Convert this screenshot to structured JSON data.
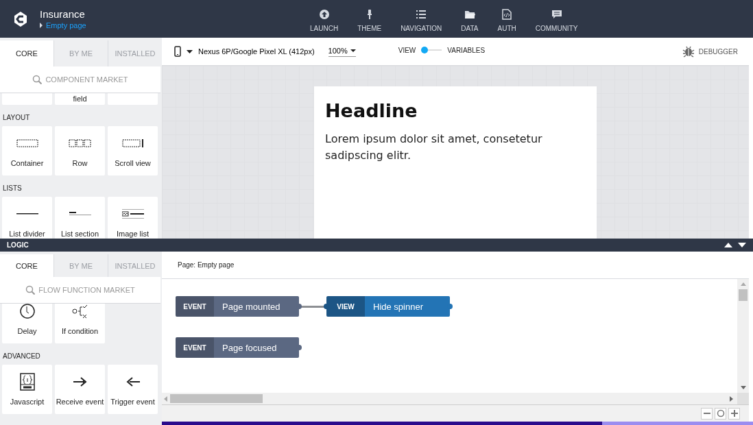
{
  "app": {
    "title": "Insurance",
    "page": "Empty page"
  },
  "nav": [
    {
      "label": "LAUNCH",
      "kind": "launch"
    },
    {
      "label": "THEME",
      "kind": "theme"
    },
    {
      "label": "NAVIGATION",
      "kind": "navigation"
    },
    {
      "label": "DATA",
      "kind": "data"
    },
    {
      "label": "AUTH",
      "kind": "auth"
    },
    {
      "label": "COMMUNITY",
      "kind": "community"
    }
  ],
  "components": {
    "tabs": [
      {
        "label": "CORE",
        "selected": true
      },
      {
        "label": "BY ME",
        "selected": false
      },
      {
        "label": "INSTALLED",
        "selected": false
      }
    ],
    "search": {
      "placeholder": "COMPONENT MARKET"
    },
    "sections": [
      {
        "tiles": [
          {
            "kind": "blank"
          },
          {
            "kind": "blank",
            "label": "field"
          },
          {
            "kind": "blank"
          }
        ]
      },
      {
        "title": "LAYOUT",
        "tiles": [
          {
            "kind": "container",
            "label": "Container"
          },
          {
            "kind": "row",
            "label": "Row"
          },
          {
            "kind": "scroll",
            "label": "Scroll view"
          }
        ]
      },
      {
        "title": "LISTS",
        "tiles": [
          {
            "kind": "divider",
            "label": "List divider"
          },
          {
            "kind": "section-header",
            "label": "List section"
          },
          {
            "kind": "image-list",
            "label": "Image list"
          }
        ]
      }
    ]
  },
  "toolbar": {
    "device": "Nexus 6P/Google Pixel XL (412px)",
    "zoom": "100%",
    "toggle": {
      "left": "VIEW",
      "right": "VARIABLES",
      "on": false
    },
    "debugger": "DEBUGGER"
  },
  "preview": {
    "headline": "Headline",
    "body": "Lorem ipsum dolor sit amet, consetetur sadipscing elitr."
  },
  "logic": {
    "title": "LOGIC",
    "functions": {
      "tabs": [
        {
          "label": "CORE",
          "selected": true
        },
        {
          "label": "BY ME",
          "selected": false
        },
        {
          "label": "INSTALLED",
          "selected": false
        }
      ],
      "search": {
        "placeholder": "FLOW FUNCTION MARKET"
      },
      "sections": [
        {
          "tiles": [
            {
              "kind": "delay",
              "label": "Delay"
            },
            {
              "kind": "condition",
              "label": "If condition"
            }
          ]
        },
        {
          "title": "ADVANCED",
          "tiles": [
            {
              "kind": "javascript",
              "label": "Javascript"
            },
            {
              "kind": "receive",
              "label": "Receive event"
            },
            {
              "kind": "trigger",
              "label": "Trigger event"
            }
          ]
        }
      ]
    },
    "page_label": "Page: Empty page",
    "flows": [
      {
        "nodes": [
          {
            "kind": "event",
            "tag": "EVENT",
            "label": "Page mounted"
          },
          {
            "kind": "view",
            "tag": "VIEW",
            "label": "Hide spinner"
          }
        ]
      },
      {
        "nodes": [
          {
            "kind": "event",
            "tag": "EVENT",
            "label": "Page focused"
          }
        ]
      }
    ]
  },
  "progress": {
    "level": 0.745
  }
}
